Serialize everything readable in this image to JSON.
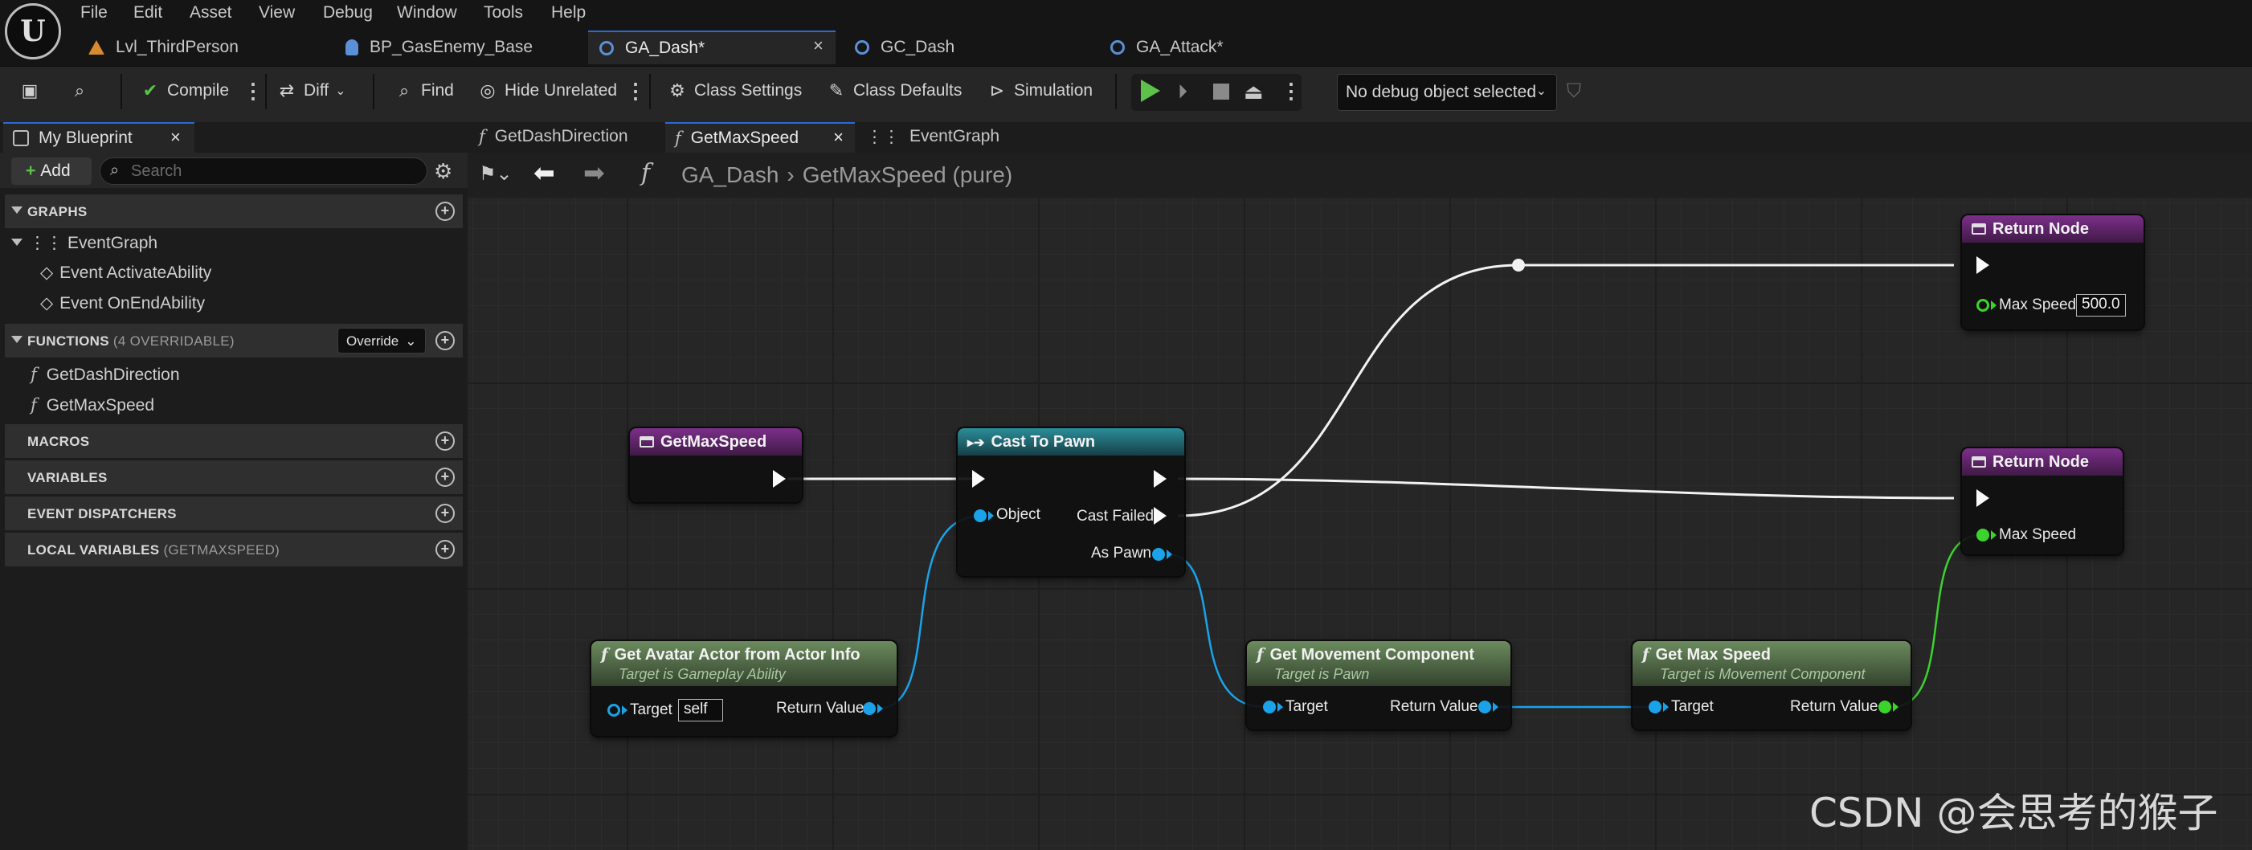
{
  "menu": [
    "File",
    "Edit",
    "Asset",
    "View",
    "Debug",
    "Window",
    "Tools",
    "Help"
  ],
  "doc_tabs": [
    {
      "label": "Lvl_ThirdPerson",
      "icon": "level-icon"
    },
    {
      "label": "BP_GasEnemy_Base",
      "icon": "person-icon"
    },
    {
      "label": "GA_Dash*",
      "icon": "blueprint-icon",
      "active": true
    },
    {
      "label": "GC_Dash",
      "icon": "blueprint-icon"
    },
    {
      "label": "GA_Attack*",
      "icon": "blueprint-icon"
    }
  ],
  "toolbar": {
    "compile": "Compile",
    "diff": "Diff",
    "find": "Find",
    "hide_unrelated": "Hide Unrelated",
    "class_settings": "Class Settings",
    "class_defaults": "Class Defaults",
    "simulation": "Simulation",
    "debug_object": "No debug object selected"
  },
  "left_panel": {
    "tab": "My Blueprint",
    "add": "Add",
    "search_placeholder": "Search",
    "graphs": "GRAPHS",
    "event_graph": "EventGraph",
    "events": [
      "Event ActivateAbility",
      "Event OnEndAbility"
    ],
    "functions": "FUNCTIONS",
    "functions_sub": "(4 OVERRIDABLE)",
    "override": "Override",
    "function_items": [
      "GetDashDirection",
      "GetMaxSpeed"
    ],
    "macros": "MACROS",
    "variables": "VARIABLES",
    "event_dispatchers": "EVENT DISPATCHERS",
    "local_variables": "LOCAL VARIABLES",
    "local_variables_sub": "(GETMAXSPEED)"
  },
  "graph_tabs": [
    {
      "label": "GetDashDirection"
    },
    {
      "label": "GetMaxSpeed",
      "active": true
    },
    {
      "label": "EventGraph"
    }
  ],
  "breadcrumb": {
    "root": "GA_Dash",
    "current": "GetMaxSpeed (pure)"
  },
  "nodes": {
    "entry": {
      "title": "GetMaxSpeed"
    },
    "cast": {
      "title": "Cast To Pawn",
      "object": "Object",
      "cast_failed": "Cast Failed",
      "as_pawn": "As Pawn"
    },
    "return1": {
      "title": "Return Node",
      "pin": "Max Speed",
      "value": "500.0"
    },
    "return2": {
      "title": "Return Node",
      "pin": "Max Speed"
    },
    "avatar": {
      "title": "Get Avatar Actor from Actor Info",
      "subtitle": "Target is Gameplay Ability",
      "target": "Target",
      "target_value": "self",
      "ret": "Return Value"
    },
    "movement": {
      "title": "Get Movement Component",
      "subtitle": "Target is Pawn",
      "target": "Target",
      "ret": "Return Value"
    },
    "maxspeed": {
      "title": "Get Max Speed",
      "subtitle": "Target is Movement Component",
      "target": "Target",
      "ret": "Return Value"
    }
  },
  "colors": {
    "exec": "#fafafa",
    "object_pin": "#1aa3e8",
    "float_pin": "#3bd42c",
    "accent": "#2a6ad4"
  },
  "watermark": "CSDN @会思考的猴子"
}
